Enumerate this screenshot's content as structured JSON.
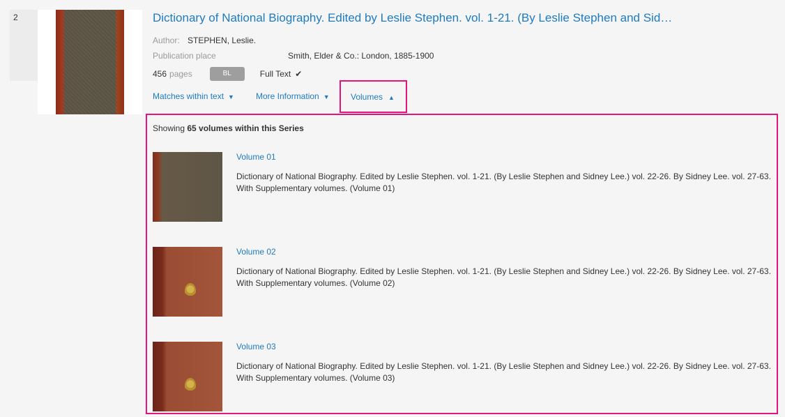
{
  "result": {
    "index": "2",
    "title": "Dictionary of National Biography. Edited by Leslie Stephen. vol. 1-21. (By Leslie Stephen and Sid…",
    "author_label": "Author:",
    "author_value": "STEPHEN, Leslie.",
    "pubplace_label": "Publication place",
    "pubplace_value": "Smith, Elder & Co.: London, 1885-1900",
    "pages_num": "456",
    "pages_unit": "pages",
    "badge": "BL",
    "fulltext": "Full Text",
    "check_icon": "✔"
  },
  "tabs": {
    "matches": "Matches within text",
    "more": "More Information",
    "volumes": "Volumes",
    "caret_down": "▼",
    "caret_up": "▲"
  },
  "volumes_panel": {
    "showing_prefix": "Showing",
    "showing_bold": "65 volumes within this Series",
    "items": [
      {
        "link": "Volume 01",
        "desc": "Dictionary of National Biography. Edited by Leslie Stephen. vol. 1-21. (By Leslie Stephen and Sidney Lee.) vol. 22-26. By Sidney Lee. vol. 27-63. With Supplementary volumes. (Volume 01)"
      },
      {
        "link": "Volume 02",
        "desc": "Dictionary of National Biography. Edited by Leslie Stephen. vol. 1-21. (By Leslie Stephen and Sidney Lee.) vol. 22-26. By Sidney Lee. vol. 27-63. With Supplementary volumes. (Volume 02)"
      },
      {
        "link": "Volume 03",
        "desc": "Dictionary of National Biography. Edited by Leslie Stephen. vol. 1-21. (By Leslie Stephen and Sidney Lee.) vol. 22-26. By Sidney Lee. vol. 27-63. With Supplementary volumes. (Volume 03)"
      }
    ]
  },
  "colors": {
    "link": "#1e7bc0",
    "highlight": "#e3147b",
    "badge_bg": "#9e9e9e"
  }
}
